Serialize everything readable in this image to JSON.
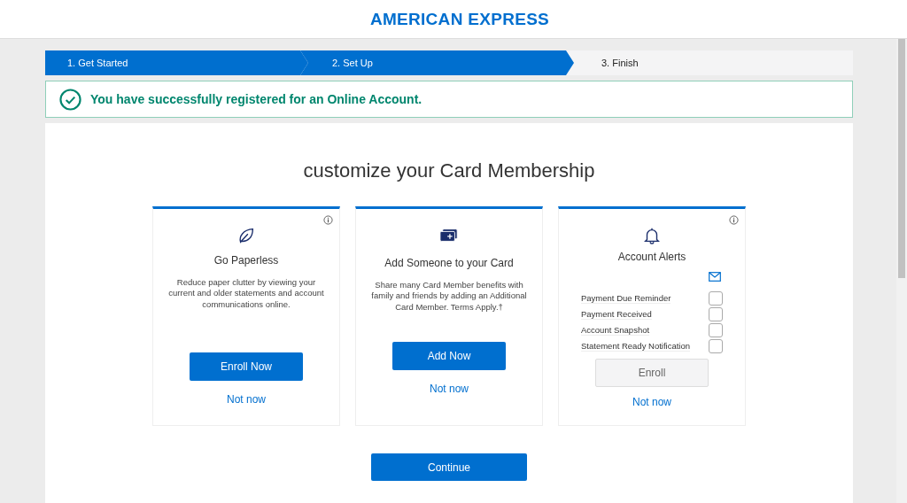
{
  "header": {
    "logo": "AMERICAN EXPRESS"
  },
  "steps": [
    {
      "label": "1.  Get Started",
      "active": true
    },
    {
      "label": "2.  Set Up",
      "active": true
    },
    {
      "label": "3.  Finish",
      "active": false
    }
  ],
  "banner": {
    "message": "You have successfully registered for an Online Account."
  },
  "heading": "customize your Card Membership",
  "cards": [
    {
      "kind": "paperless",
      "title": "Go Paperless",
      "info": true,
      "description": "Reduce paper clutter by viewing your current and older statements and account communications online.",
      "button": {
        "label": "Enroll Now",
        "disabled": false
      },
      "link": "Not now"
    },
    {
      "kind": "add_member",
      "title": "Add Someone to your Card",
      "info": false,
      "description": "Share many Card Member benefits with family and friends by adding an Additional Card Member. Terms Apply.†",
      "button": {
        "label": "Add Now",
        "disabled": false
      },
      "link": "Not now"
    },
    {
      "kind": "alerts",
      "title": "Account Alerts",
      "info": true,
      "alerts": [
        {
          "label": "Payment Due Reminder",
          "checked": false
        },
        {
          "label": "Payment Received",
          "checked": false
        },
        {
          "label": "Account Snapshot",
          "checked": false
        },
        {
          "label": "Statement Ready Notification",
          "checked": false
        }
      ],
      "button": {
        "label": "Enroll",
        "disabled": true
      },
      "link": "Not now"
    }
  ],
  "continue_button": "Continue"
}
